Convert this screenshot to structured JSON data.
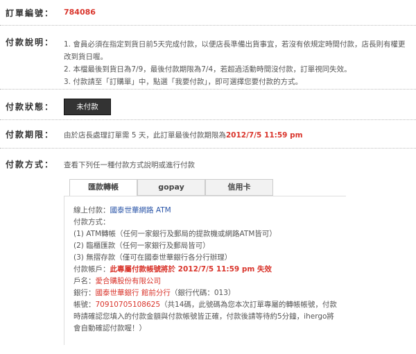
{
  "order": {
    "label": "訂單編號：",
    "number": "784086"
  },
  "explanation": {
    "label": "付款說明：",
    "items": [
      "1. 會員必須在指定到貨日前5天完成付款，以便店長準備出貨事宜，若沒有依規定時間付款，店長則有權更改到貨日喔。",
      "2. 本檔最後到貨日為7/9，最後付款期限為7/4，若超過活動時間沒付款，訂單視同失效。",
      "3. 付款請至「訂購單」中，點選「我要付款」，即可選擇您要付款的方式。"
    ]
  },
  "status": {
    "label": "付款狀態：",
    "value": "未付款"
  },
  "deadline": {
    "label": "付款期限：",
    "prefix": "由於店長處理訂單需 5 天，此訂單最後付款期限為",
    "datetime": "2012/7/5  11:59 pm"
  },
  "method": {
    "label": "付款方式：",
    "intro": "查看下列任一種付款方式說明或進行付款",
    "tabs": [
      "匯款轉帳",
      "gopay",
      "信用卡"
    ],
    "panel": {
      "online_label": "線上付款：",
      "online_link": "國泰世華網路 ATM",
      "methods_label": "付款方式：",
      "method_1": "(1) ATM轉帳（任何一家銀行及郵局的提款機或網路ATM皆可）",
      "method_2": "(2) 臨櫃匯款（任何一家銀行及郵局皆可）",
      "method_3": "(3) 無摺存款（僅可在國泰世華銀行各分行辦理）",
      "account_label": "付款帳戶：",
      "account_expire": "此專屬付款帳號將於 2012/7/5  11:59 pm 失效",
      "name_label": "戶名：",
      "name_value": "愛合購股份有限公司",
      "bank_label": "銀行：",
      "bank_value": "國泰世華銀行 館前分行",
      "bank_code": "（銀行代碼：013）",
      "acct_label": "帳號：",
      "acct_number": "70910705108625",
      "acct_note": "（共14碼，此號碼為您本次訂單專屬的轉帳帳號，付款時請確認您填入的付款金額與付款帳號皆正確，付款後請等待約5分鐘，ihergo將會自動確認付款喔！）"
    }
  }
}
